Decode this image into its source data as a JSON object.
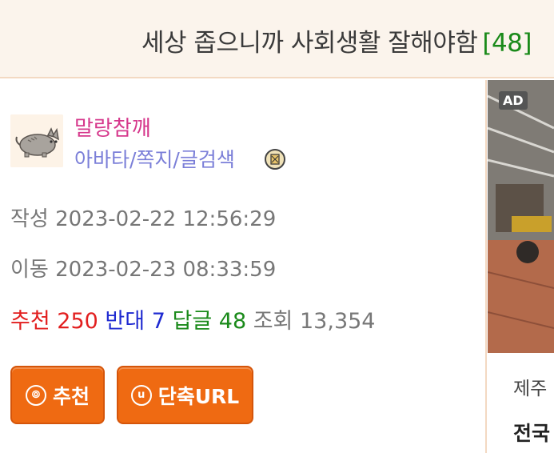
{
  "header": {
    "title": "세상 좁으니까 사회생활 잘해야함",
    "reply_count": "[48]"
  },
  "author": {
    "avatar_icon": "cat-avatar-icon",
    "nickname": "말랑참깨",
    "links": "아바타/쪽지/글검색",
    "badge_icon": "level-badge-icon"
  },
  "post_meta": {
    "written_label": "작성",
    "written_value": "2023-02-22 12:56:29",
    "moved_label": "이동",
    "moved_value": "2023-02-23 08:33:59"
  },
  "stats": {
    "recommend_label": "추천",
    "recommend_value": "250",
    "oppose_label": "반대",
    "oppose_value": "7",
    "reply_label": "답글",
    "reply_value": "48",
    "views_label": "조회",
    "views_value": "13,354"
  },
  "buttons": {
    "recommend": "추천",
    "recommend_icon": "⦾",
    "short_url": "단축URL",
    "short_url_icon": "u"
  },
  "sidebar": {
    "ad_badge": "AD",
    "text1": "제주",
    "text2": "전국"
  },
  "colors": {
    "accent_orange": "#ef6a12",
    "recommend_red": "#e21f1f",
    "oppose_blue": "#1f2ad1",
    "reply_green": "#1a8a1a",
    "nickname_pink": "#d6388c"
  }
}
